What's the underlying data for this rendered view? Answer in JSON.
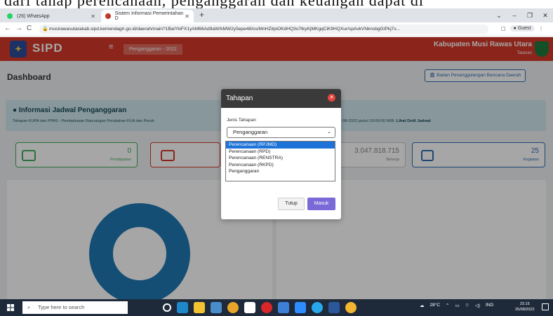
{
  "doc": {
    "top_text": "dari tahap perencanaan, penganggaran dan keuangan dapat di"
  },
  "browser": {
    "tabs": [
      {
        "label": "(26) WhatsApp",
        "color": "#25d366"
      },
      {
        "label": "Sistem Informasi Pemerintahan D",
        "color": "#c0392b"
      }
    ],
    "url": "musirawasutarakab.sipd.kemendagri.go.id/daerah/main?1BaiYkiFX1yAM66Ad9aW/kMW2y5epe48/os/MnHZitpiOKdHQ3o7tkyKjMKgqCiK9HQXur/spAvkVNknsbgGIPkj7s...",
    "profile": "Guest"
  },
  "app": {
    "brand": "SIPD",
    "period": "Penganggaran - 2022",
    "region": "Kabupaten Musi Rawas Utara",
    "region_sub": "Tatanan",
    "page_title": "Dashboard",
    "agency_button": "Badan Penanggulangan Bencana Daerah",
    "info_title": "Informasi Jadwal Penganggaran",
    "info_text": "Tahapan KUPA dan PPAS - Pembahasan Rancangan Perubahan KUA dan Perub",
    "info_right": "08-2022 pukul 10:00:00 WIB.",
    "info_link": "Lihat Detil Jadwal",
    "cards": [
      {
        "value": "0",
        "label": "Pendapatan"
      },
      {
        "value": "3.047.818.715",
        "label": "Belanja"
      },
      {
        "value": "25",
        "label": "Kegiatan"
      }
    ]
  },
  "modal": {
    "title": "Tahapan",
    "field_label": "Jenis Tahapan",
    "selected": "Penganggaran",
    "options": [
      "Perencanaan (RPJMD)",
      "Perencanaan (RPD)",
      "Perencanaan (RENSTRA)",
      "Perencanaan (RKPD)",
      "Penganggaran"
    ],
    "cancel_label": "Tutup",
    "submit_label": "Masuk"
  },
  "taskbar": {
    "search_placeholder": "Type here to search",
    "weather": "28°C",
    "lang": "IND",
    "time": "23.15",
    "date": "25/08/2022"
  }
}
